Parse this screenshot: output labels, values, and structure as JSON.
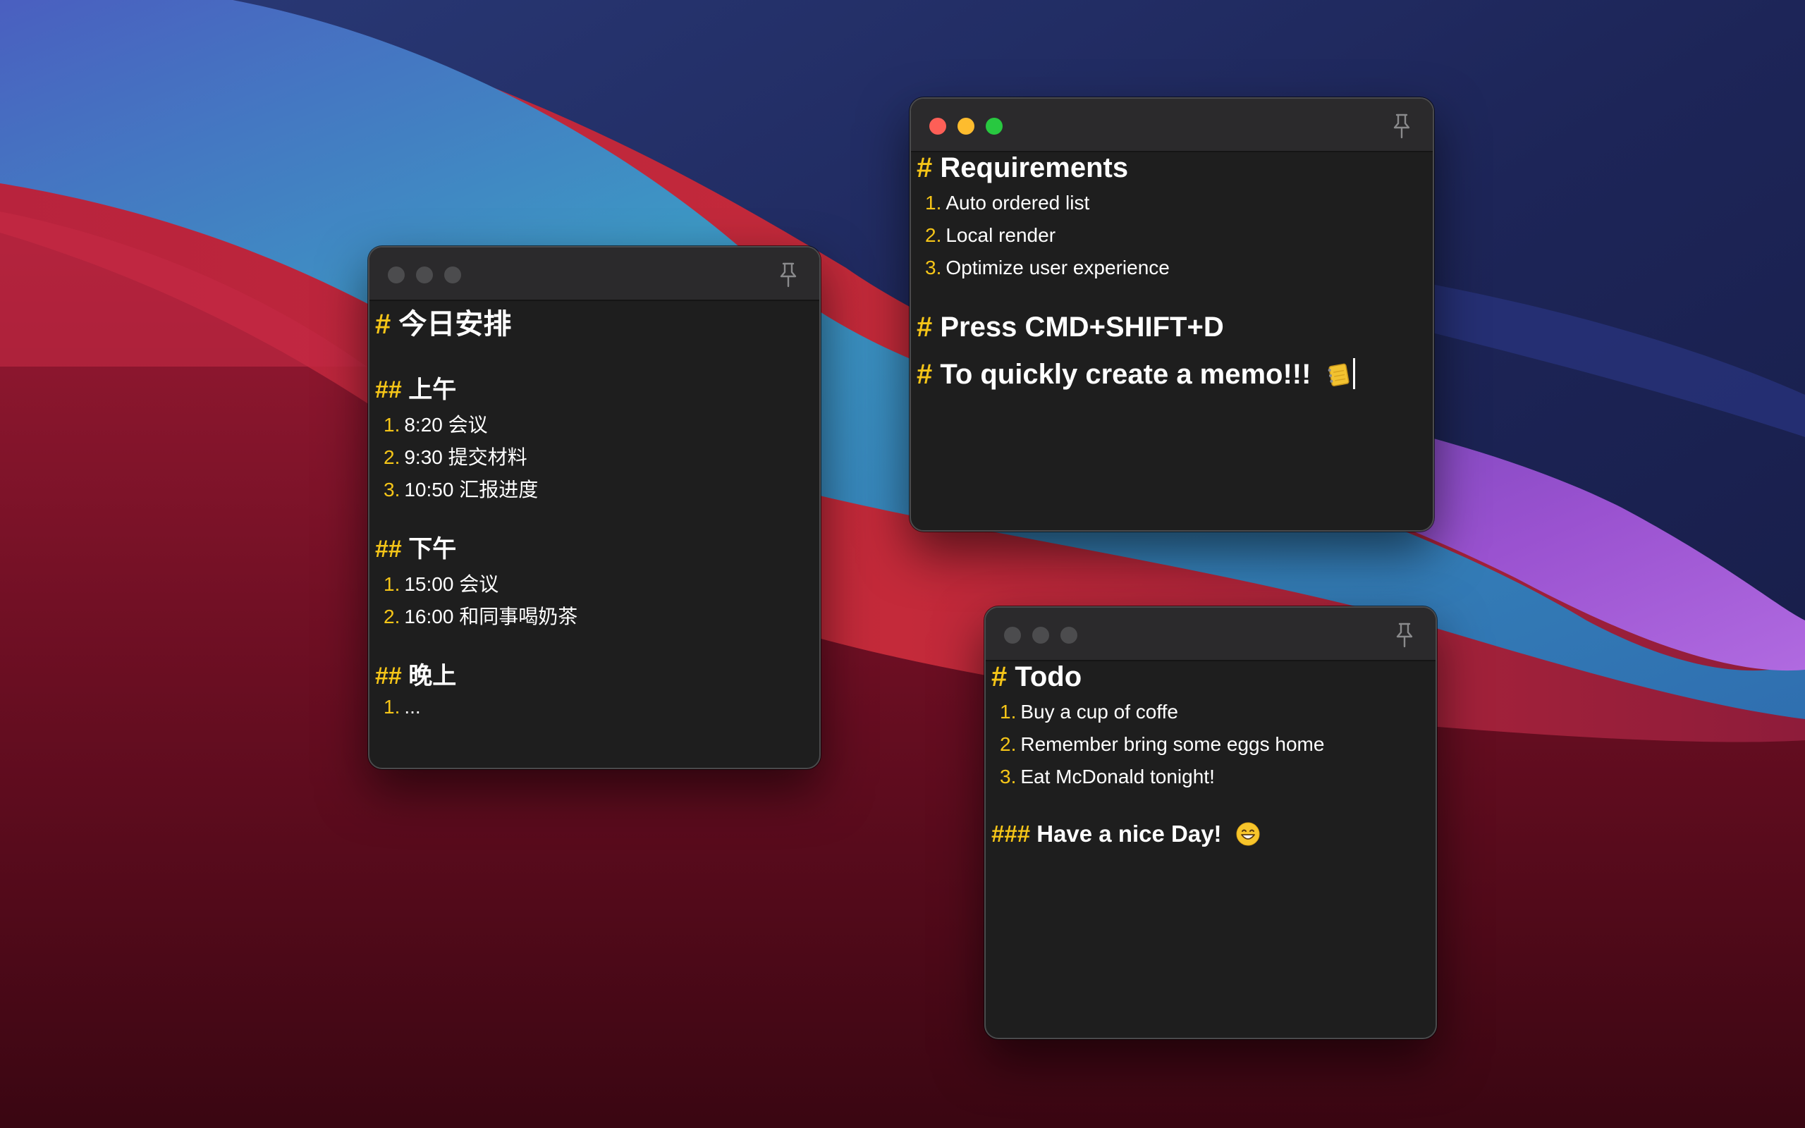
{
  "icons": {
    "pin": "pushpin-icon",
    "memo": "memo-notebook-icon",
    "smile": "grinning-face-icon"
  },
  "colors": {
    "accent": "#f5c518",
    "note_bg": "#1e1e1e",
    "titlebar_bg": "#2b2a2c",
    "close": "#fe5f57",
    "minimize": "#febc2e",
    "maximize": "#28c840"
  },
  "note_left": {
    "title": {
      "hash": "#",
      "text": "今日安排"
    },
    "morning": {
      "hash": "##",
      "text": "上午",
      "items": [
        {
          "num": "1.",
          "text": "8:20 会议"
        },
        {
          "num": "2.",
          "text": "9:30 提交材料"
        },
        {
          "num": "3.",
          "text": "10:50 汇报进度"
        }
      ]
    },
    "afternoon": {
      "hash": "##",
      "text": "下午",
      "items": [
        {
          "num": "1.",
          "text": "15:00 会议"
        },
        {
          "num": "2.",
          "text": "16:00 和同事喝奶茶"
        }
      ]
    },
    "evening": {
      "hash": "##",
      "text": "晚上",
      "items": [
        {
          "num": "1.",
          "text": "..."
        }
      ]
    }
  },
  "note_top": {
    "title": {
      "hash": "#",
      "text": "Requirements"
    },
    "items": [
      {
        "num": "1.",
        "text": "Auto ordered list"
      },
      {
        "num": "2.",
        "text": "Local render"
      },
      {
        "num": "3.",
        "text": "Optimize user experience"
      }
    ],
    "heading2": {
      "hash": "#",
      "text": "Press CMD+SHIFT+D"
    },
    "heading3": {
      "hash": "#",
      "text": "To quickly create a memo!!!"
    }
  },
  "note_bottom": {
    "title": {
      "hash": "#",
      "text": "Todo"
    },
    "items": [
      {
        "num": "1.",
        "text": "Buy a cup of coffe"
      },
      {
        "num": "2.",
        "text": "Remember bring some eggs home"
      },
      {
        "num": "3.",
        "text": "Eat McDonald tonight!"
      }
    ],
    "footer": {
      "hash": "###",
      "text": "Have a nice Day!"
    }
  }
}
